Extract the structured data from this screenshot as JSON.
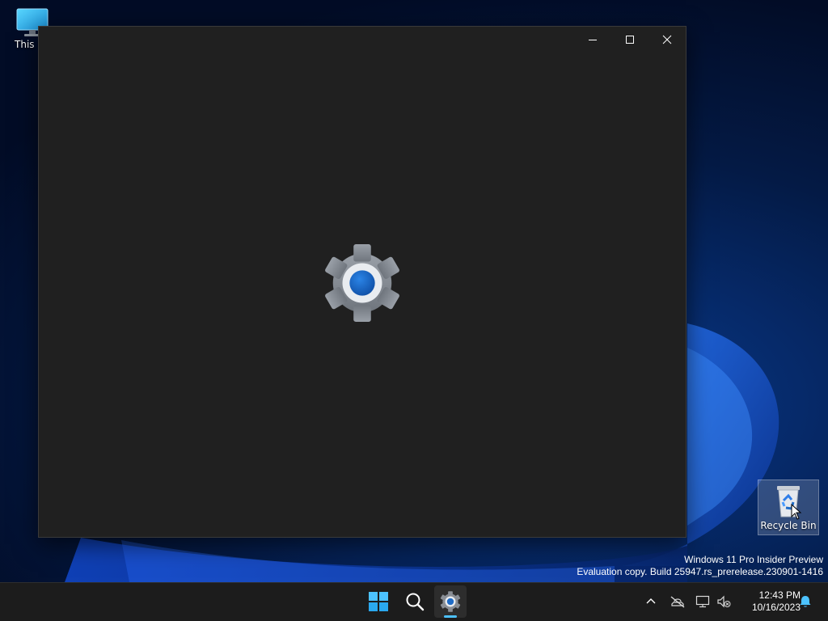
{
  "desktop": {
    "icons": [
      {
        "label": "This PC",
        "icon": "monitor-icon"
      },
      {
        "label": "Recycle Bin",
        "icon": "recycle-bin-icon"
      }
    ],
    "watermark": {
      "line1": "Windows 11 Pro Insider Preview",
      "line2": "Evaluation copy. Build 25947.rs_prerelease.230901-1416"
    }
  },
  "window": {
    "app": "Settings",
    "splash_icon": "gear-icon",
    "caption_buttons": [
      "minimize-icon",
      "maximize-icon",
      "close-icon"
    ],
    "background": "#202020"
  },
  "taskbar": {
    "pinned": [
      {
        "icon": "windows-start-icon"
      },
      {
        "icon": "search-icon"
      },
      {
        "icon": "settings-gear-icon",
        "running": true,
        "active": true
      }
    ],
    "tray": {
      "icons": [
        "chevron-up-icon",
        "network-disconnected-icon",
        "display-icon",
        "sound-muted-icon",
        "notification-bell-icon"
      ],
      "time": "12:43 PM",
      "date": "10/16/2023"
    }
  },
  "colors": {
    "accent": "#4cc2ff",
    "window_bg": "#202020",
    "taskbar_bg": "#1c1c1c",
    "gear_gray": "#8a8f96",
    "gear_blue": "#1f6cc7"
  }
}
